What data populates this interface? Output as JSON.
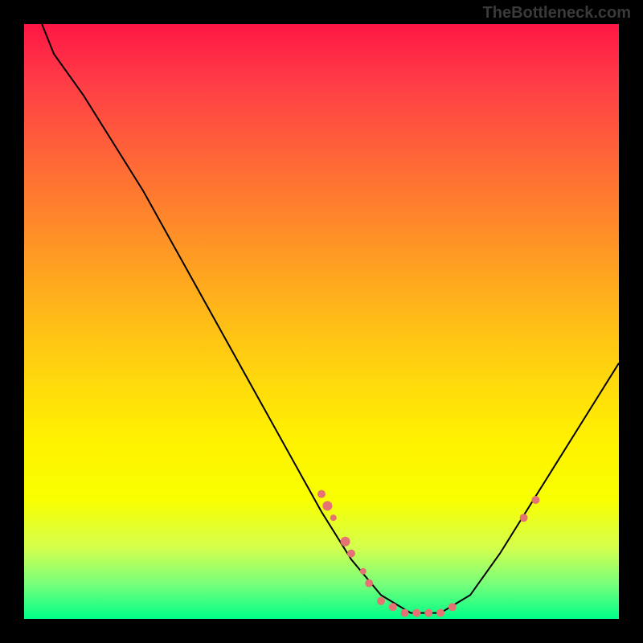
{
  "watermark": "TheBottleneck.com",
  "chart_data": {
    "type": "line",
    "title": "",
    "xlabel": "",
    "ylabel": "",
    "xlim": [
      0,
      100
    ],
    "ylim": [
      0,
      100
    ],
    "curve": {
      "description": "V-shaped bottleneck curve with minimum around x=67",
      "points": [
        {
          "x": 3,
          "y": 100
        },
        {
          "x": 5,
          "y": 95
        },
        {
          "x": 10,
          "y": 88
        },
        {
          "x": 15,
          "y": 80
        },
        {
          "x": 20,
          "y": 72
        },
        {
          "x": 25,
          "y": 63
        },
        {
          "x": 30,
          "y": 54
        },
        {
          "x": 35,
          "y": 45
        },
        {
          "x": 40,
          "y": 36
        },
        {
          "x": 45,
          "y": 27
        },
        {
          "x": 50,
          "y": 18
        },
        {
          "x": 55,
          "y": 10
        },
        {
          "x": 60,
          "y": 4
        },
        {
          "x": 65,
          "y": 1
        },
        {
          "x": 70,
          "y": 1
        },
        {
          "x": 75,
          "y": 4
        },
        {
          "x": 80,
          "y": 11
        },
        {
          "x": 85,
          "y": 19
        },
        {
          "x": 90,
          "y": 27
        },
        {
          "x": 95,
          "y": 35
        },
        {
          "x": 100,
          "y": 43
        }
      ]
    },
    "markers": [
      {
        "x": 50,
        "y": 21,
        "size": 5
      },
      {
        "x": 51,
        "y": 19,
        "size": 6
      },
      {
        "x": 52,
        "y": 17,
        "size": 4
      },
      {
        "x": 54,
        "y": 13,
        "size": 6
      },
      {
        "x": 55,
        "y": 11,
        "size": 5
      },
      {
        "x": 57,
        "y": 8,
        "size": 4
      },
      {
        "x": 58,
        "y": 6,
        "size": 5
      },
      {
        "x": 60,
        "y": 3,
        "size": 5
      },
      {
        "x": 62,
        "y": 2,
        "size": 5
      },
      {
        "x": 64,
        "y": 1,
        "size": 5
      },
      {
        "x": 66,
        "y": 1,
        "size": 5
      },
      {
        "x": 68,
        "y": 1,
        "size": 5
      },
      {
        "x": 70,
        "y": 1,
        "size": 5
      },
      {
        "x": 72,
        "y": 2,
        "size": 5
      },
      {
        "x": 84,
        "y": 17,
        "size": 5
      },
      {
        "x": 86,
        "y": 20,
        "size": 5
      }
    ],
    "colors": {
      "curve": "#000000",
      "marker": "#e57373",
      "gradient_top": "#ff1744",
      "gradient_bottom": "#00ff88"
    }
  }
}
